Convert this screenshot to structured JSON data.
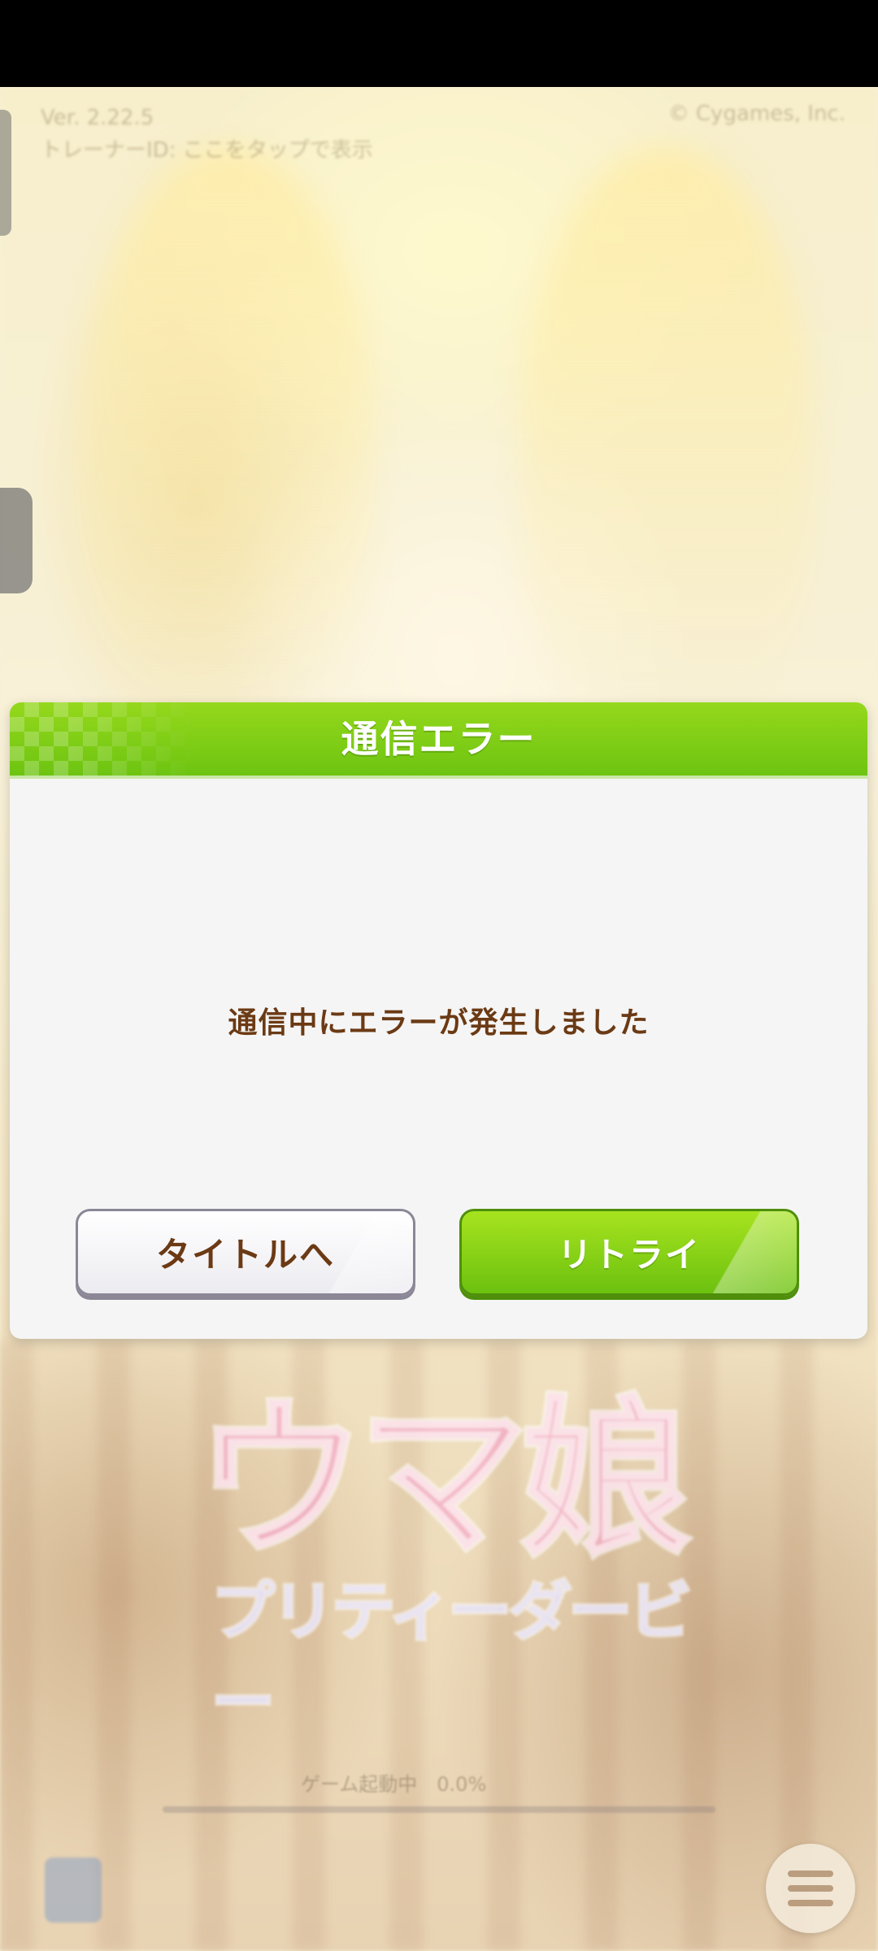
{
  "status_bar": {},
  "background": {
    "version": "Ver. 2.22.5",
    "trainer_id": "トレーナーID: ここをタップで表示",
    "copyright": "© Cygames, Inc.",
    "logo_main": "ウマ娘",
    "logo_sub": "プリティーダービー",
    "loading_label": "ゲーム起動中　0.0%",
    "menu_icon": "hamburger-menu-icon",
    "badge_icon": "app-badge-icon"
  },
  "dialog": {
    "title": "通信エラー",
    "message": "通信中にエラーが発生しました",
    "buttons": {
      "title_label": "タイトルへ",
      "retry_label": "リトライ"
    },
    "colors": {
      "header_green": "#7ccb14",
      "message_brown": "#6b3a14",
      "retry_green": "#8fd416"
    }
  }
}
